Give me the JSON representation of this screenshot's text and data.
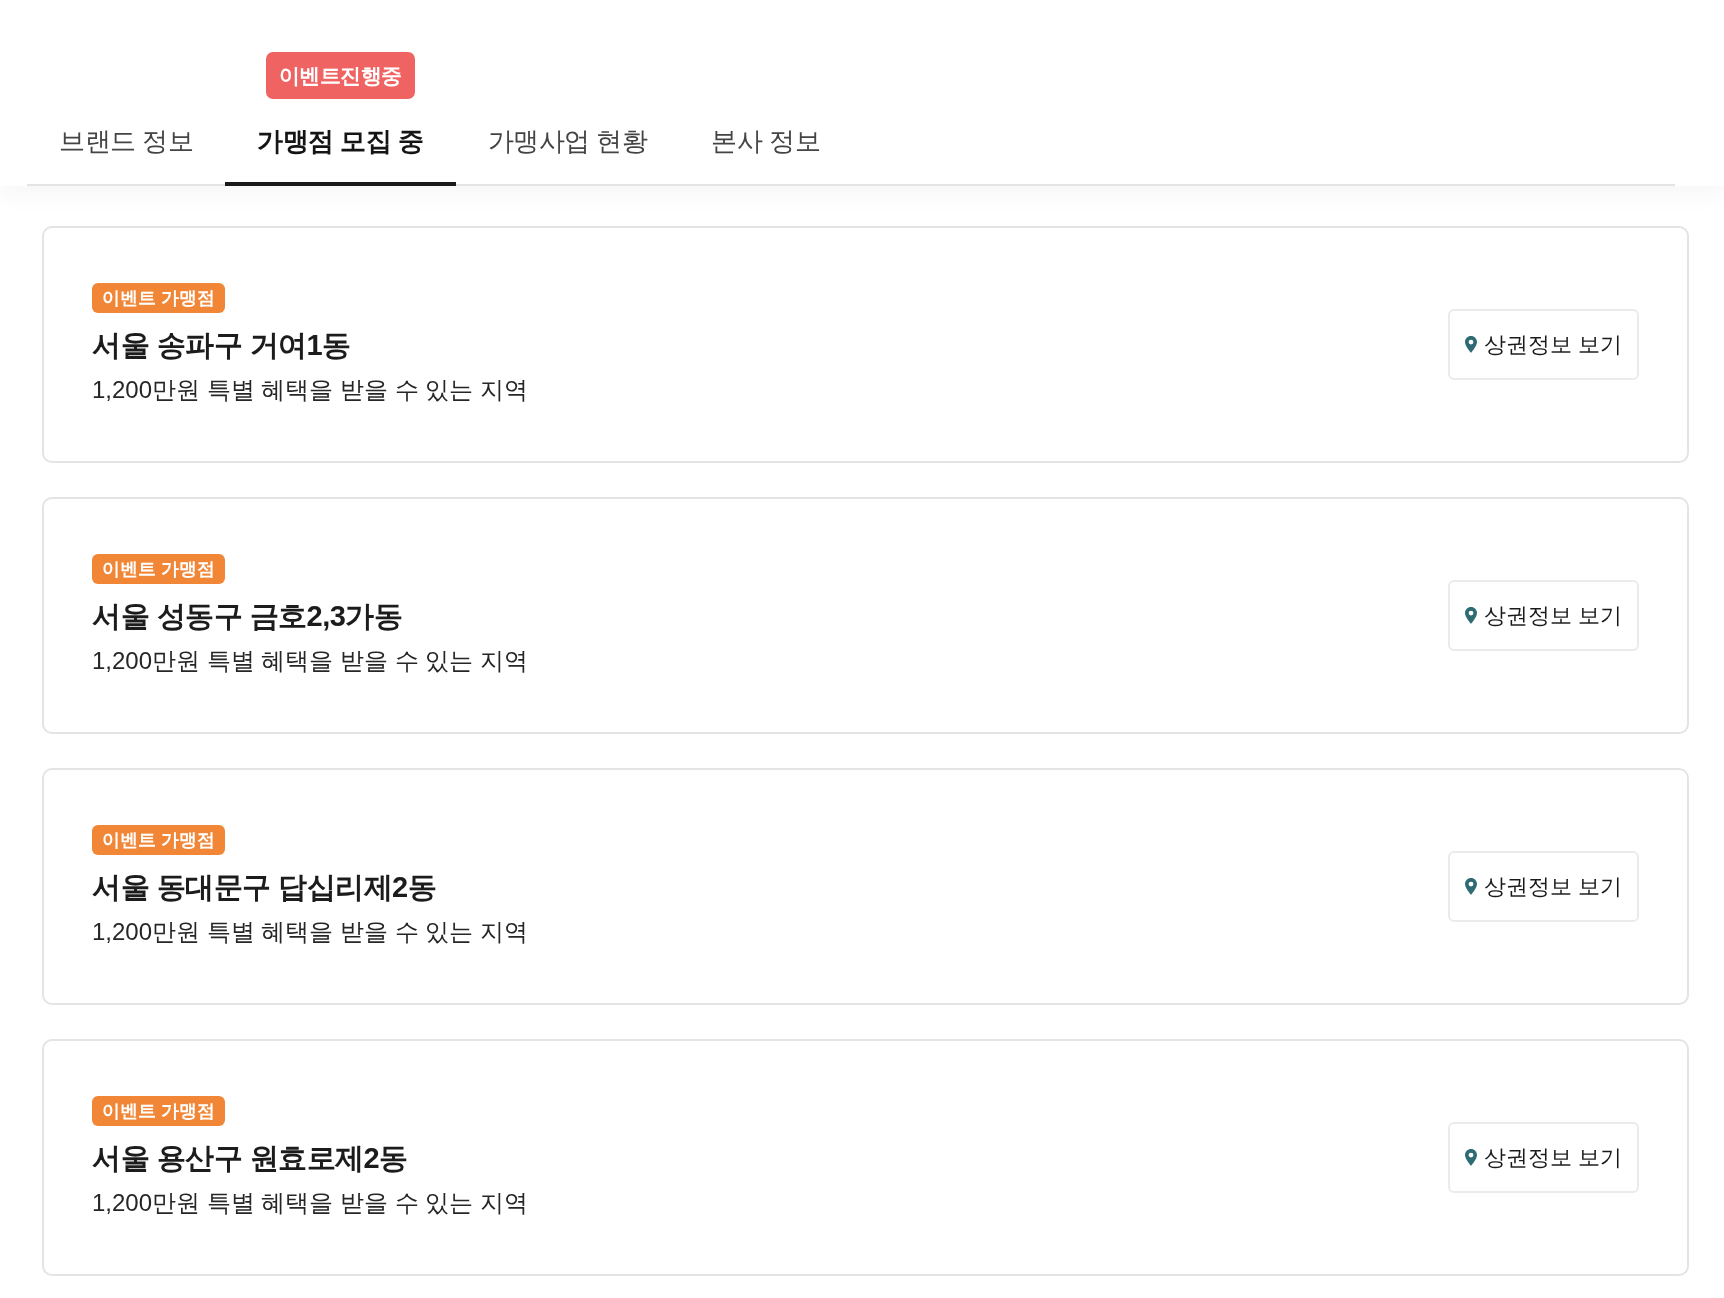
{
  "tabs": [
    {
      "label": "브랜드 정보",
      "selected": false
    },
    {
      "label": "가맹점 모집 중",
      "selected": true,
      "badge": "이벤트진행중"
    },
    {
      "label": "가맹사업 현황",
      "selected": false
    },
    {
      "label": "본사 정보",
      "selected": false
    }
  ],
  "listings": [
    {
      "badge": "이벤트 가맹점",
      "title": "서울 송파구 거여1동",
      "description": "1,200만원 특별 혜택을 받을 수 있는 지역",
      "button": "상권정보 보기"
    },
    {
      "badge": "이벤트 가맹점",
      "title": "서울 성동구 금호2,3가동",
      "description": "1,200만원 특별 혜택을 받을 수 있는 지역",
      "button": "상권정보 보기"
    },
    {
      "badge": "이벤트 가맹점",
      "title": "서울 동대문구 답십리제2동",
      "description": "1,200만원 특별 혜택을 받을 수 있는 지역",
      "button": "상권정보 보기"
    },
    {
      "badge": "이벤트 가맹점",
      "title": "서울 용산구 원효로제2동",
      "description": "1,200만원 특별 혜택을 받을 수 있는 지역",
      "button": "상권정보 보기"
    }
  ]
}
